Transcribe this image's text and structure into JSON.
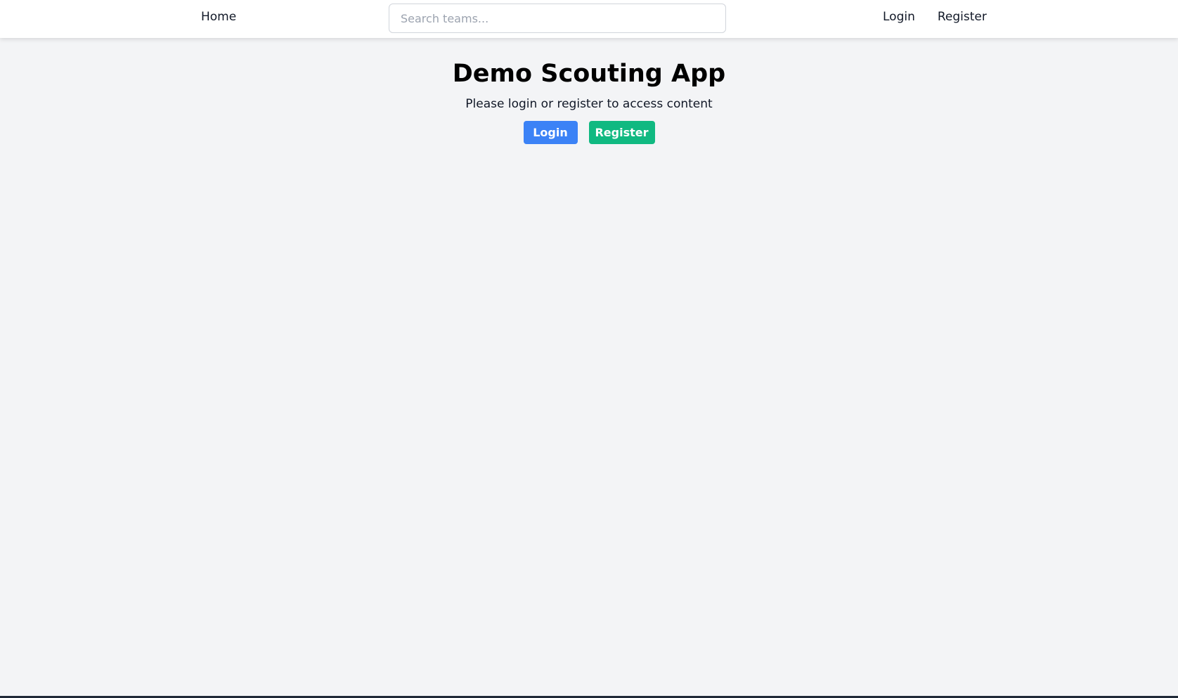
{
  "nav": {
    "home_label": "Home",
    "search_placeholder": "Search teams...",
    "login_label": "Login",
    "register_label": "Register"
  },
  "main": {
    "title": "Demo Scouting App",
    "subtitle": "Please login or register to access content",
    "login_button": "Login",
    "register_button": "Register"
  },
  "colors": {
    "background": "#f3f4f6",
    "primary": "#3b82f6",
    "success": "#10b981"
  }
}
